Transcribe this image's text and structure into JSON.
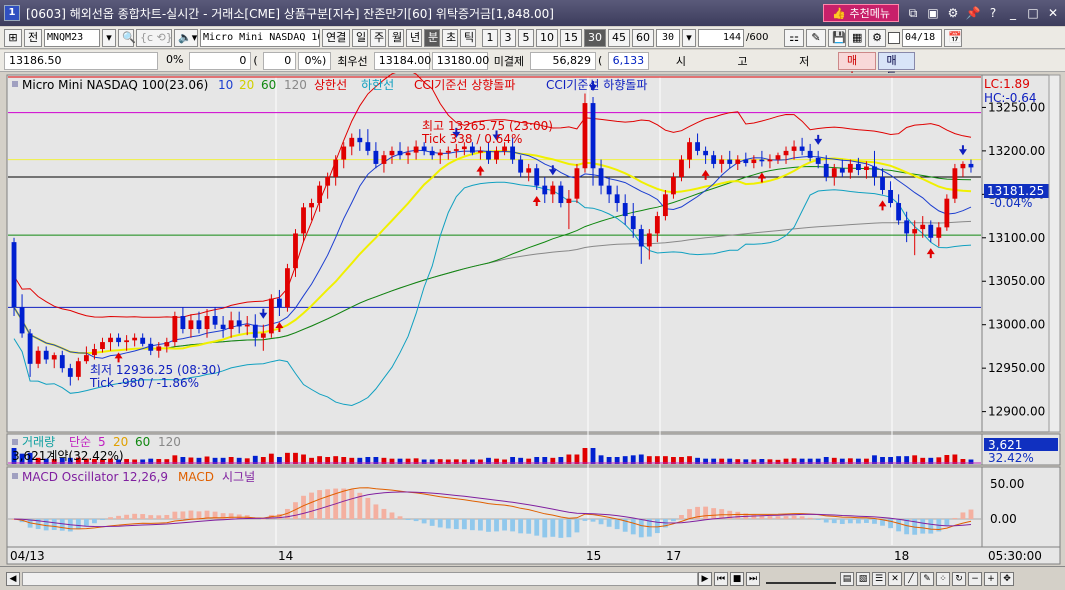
{
  "window": {
    "number": "1",
    "title": "[0603] 해외선옵 종합차트-실시간 - 거래소[CME] 상품구분[지수] 잔존만기[60] 위탁증거금[1,848.00]",
    "recommend_menu": "추천메뉴"
  },
  "toolbar": {
    "jeon": "전",
    "symbol": "MNQM23",
    "product_name": "Micro Mini NASDAQ 10",
    "yeongyeol": "연결",
    "periods": [
      "일",
      "주",
      "월",
      "년",
      "분",
      "초",
      "틱"
    ],
    "active_period": "분",
    "intervals": [
      "1",
      "3",
      "5",
      "10",
      "15",
      "30",
      "45",
      "60"
    ],
    "active_interval": "30",
    "interval_select": "30",
    "count": "144",
    "count_total": "/600",
    "date": "04/18"
  },
  "quote": {
    "price": "13186.50",
    "change": "0",
    "change_pct_tail": "0%",
    "paren_value": "0",
    "paren_pct": "0%)",
    "best_bid_label": "최우선",
    "best_bid": "13184.00",
    "best_ask": "13180.00",
    "open_interest_label": "미결제",
    "open_interest": "56,829",
    "oi_change": "6,133",
    "open_label": "시",
    "high_label": "고",
    "low_label": "저",
    "buy_label": "매수",
    "sell_label": "매도"
  },
  "price_panel": {
    "legend_name": "Micro Mini NASDAQ 100(23.06)",
    "ma_periods": [
      {
        "label": "10",
        "color": "#1c3ed0"
      },
      {
        "label": "20",
        "color": "#e0e000"
      },
      {
        "label": "60",
        "color": "#108810"
      },
      {
        "label": "120",
        "color": "#888888"
      }
    ],
    "upper_band_label": "상한선",
    "lower_band_label": "하한선",
    "cci_up_label": "CCI기준선 상향돌파",
    "cci_down_label": "CCI기준선 하향돌파",
    "lc_label": "LC:1.89",
    "hc_label": "HC:-0.64",
    "high_annot": "최고 13265.75 (23:00)",
    "high_tick": "Tick 338 / 0.64%",
    "low_annot": "최저 12936.25 (08:30)",
    "low_tick": "Tick -980 / -1.86%",
    "current_price_label": "13181.25",
    "current_pct_label": "-0.04%",
    "y_ticks": [
      "13250.00",
      "13200.00",
      "13150.00",
      "13100.00",
      "13050.00",
      "13000.00",
      "12950.00",
      "12900.00"
    ]
  },
  "volume_panel": {
    "label": "거래량",
    "ma_type": "단순",
    "ma_periods": [
      "5",
      "20",
      "60",
      "120"
    ],
    "contracts_label": "3,621계약(32.42%)",
    "value_label": "3,621",
    "pct_label": "32.42%"
  },
  "macd_panel": {
    "osc_label": "MACD Oscillator 12,26,9",
    "macd_label": "MACD",
    "signal_label": "시그널",
    "y_ticks": [
      "50.00",
      "0.00"
    ]
  },
  "x_axis": {
    "labels": [
      "04/13",
      "14",
      "15",
      "17",
      "18"
    ],
    "time_label": "05:30:00"
  },
  "chart_data": {
    "type": "candlestick",
    "ylim": [
      12880,
      13285
    ],
    "candles": [
      [
        13095,
        13100,
        13010,
        13020
      ],
      [
        13020,
        13035,
        12985,
        12990
      ],
      [
        12990,
        12995,
        12940,
        12955
      ],
      [
        12955,
        12975,
        12950,
        12970
      ],
      [
        12970,
        12975,
        12955,
        12960
      ],
      [
        12960,
        12968,
        12950,
        12965
      ],
      [
        12965,
        12970,
        12945,
        12950
      ],
      [
        12950,
        12955,
        12930,
        12940
      ],
      [
        12940,
        12962,
        12936,
        12958
      ],
      [
        12958,
        12975,
        12955,
        12965
      ],
      [
        12965,
        12978,
        12960,
        12972
      ],
      [
        12972,
        12985,
        12968,
        12980
      ],
      [
        12980,
        12990,
        12970,
        12985
      ],
      [
        12985,
        12990,
        12975,
        12980
      ],
      [
        12980,
        12988,
        12970,
        12982
      ],
      [
        12982,
        12990,
        12975,
        12985
      ],
      [
        12985,
        12990,
        12975,
        12978
      ],
      [
        12978,
        12985,
        12965,
        12970
      ],
      [
        12970,
        12980,
        12962,
        12975
      ],
      [
        12975,
        12985,
        12968,
        12980
      ],
      [
        12980,
        13015,
        12975,
        13010
      ],
      [
        13010,
        13020,
        12990,
        12995
      ],
      [
        12995,
        13012,
        12985,
        13005
      ],
      [
        13005,
        13015,
        12990,
        12995
      ],
      [
        12995,
        13018,
        12985,
        13010
      ],
      [
        13010,
        13020,
        12995,
        13000
      ],
      [
        13000,
        13010,
        12985,
        12995
      ],
      [
        12995,
        13015,
        12985,
        13005
      ],
      [
        13005,
        13015,
        12990,
        12998
      ],
      [
        12998,
        13010,
        12988,
        13000
      ],
      [
        13000,
        13012,
        12975,
        12985
      ],
      [
        12985,
        13000,
        12970,
        12990
      ],
      [
        12990,
        13035,
        12985,
        13030
      ],
      [
        13030,
        13040,
        13010,
        13020
      ],
      [
        13020,
        13070,
        13015,
        13065
      ],
      [
        13065,
        13110,
        13055,
        13105
      ],
      [
        13105,
        13140,
        13095,
        13135
      ],
      [
        13135,
        13145,
        13120,
        13140
      ],
      [
        13140,
        13165,
        13130,
        13160
      ],
      [
        13160,
        13175,
        13145,
        13170
      ],
      [
        13170,
        13195,
        13160,
        13190
      ],
      [
        13190,
        13210,
        13180,
        13205
      ],
      [
        13205,
        13220,
        13195,
        13215
      ],
      [
        13215,
        13225,
        13200,
        13210
      ],
      [
        13210,
        13225,
        13195,
        13200
      ],
      [
        13200,
        13210,
        13180,
        13185
      ],
      [
        13185,
        13200,
        13175,
        13195
      ],
      [
        13195,
        13205,
        13185,
        13200
      ],
      [
        13200,
        13210,
        13190,
        13195
      ],
      [
        13195,
        13205,
        13185,
        13198
      ],
      [
        13198,
        13212,
        13190,
        13205
      ],
      [
        13205,
        13210,
        13195,
        13200
      ],
      [
        13200,
        13205,
        13190,
        13195
      ],
      [
        13195,
        13202,
        13185,
        13198
      ],
      [
        13198,
        13205,
        13190,
        13200
      ],
      [
        13200,
        13208,
        13192,
        13202
      ],
      [
        13202,
        13210,
        13195,
        13205
      ],
      [
        13205,
        13210,
        13195,
        13198
      ],
      [
        13198,
        13205,
        13190,
        13200
      ],
      [
        13200,
        13210,
        13185,
        13190
      ],
      [
        13190,
        13205,
        13185,
        13200
      ],
      [
        13200,
        13210,
        13195,
        13205
      ],
      [
        13205,
        13215,
        13185,
        13190
      ],
      [
        13190,
        13195,
        13170,
        13175
      ],
      [
        13175,
        13185,
        13165,
        13180
      ],
      [
        13180,
        13185,
        13155,
        13160
      ],
      [
        13160,
        13170,
        13140,
        13150
      ],
      [
        13150,
        13165,
        13140,
        13160
      ],
      [
        13160,
        13165,
        13135,
        13140
      ],
      [
        13140,
        13155,
        13110,
        13145
      ],
      [
        13145,
        13185,
        13140,
        13180
      ],
      [
        13180,
        13266,
        13175,
        13255
      ],
      [
        13255,
        13262,
        13160,
        13180
      ],
      [
        13180,
        13190,
        13150,
        13160
      ],
      [
        13160,
        13170,
        13140,
        13150
      ],
      [
        13150,
        13160,
        13130,
        13140
      ],
      [
        13140,
        13150,
        13115,
        13125
      ],
      [
        13125,
        13140,
        13100,
        13110
      ],
      [
        13110,
        13115,
        13070,
        13090
      ],
      [
        13090,
        13110,
        13075,
        13105
      ],
      [
        13105,
        13130,
        13095,
        13125
      ],
      [
        13125,
        13155,
        13120,
        13150
      ],
      [
        13150,
        13175,
        13145,
        13170
      ],
      [
        13170,
        13195,
        13165,
        13190
      ],
      [
        13190,
        13215,
        13180,
        13210
      ],
      [
        13210,
        13220,
        13195,
        13200
      ],
      [
        13200,
        13205,
        13185,
        13195
      ],
      [
        13195,
        13200,
        13180,
        13185
      ],
      [
        13185,
        13195,
        13175,
        13190
      ],
      [
        13190,
        13200,
        13180,
        13185
      ],
      [
        13185,
        13195,
        13178,
        13190
      ],
      [
        13190,
        13198,
        13182,
        13186
      ],
      [
        13186,
        13195,
        13180,
        13190
      ],
      [
        13190,
        13200,
        13182,
        13188
      ],
      [
        13188,
        13196,
        13180,
        13190
      ],
      [
        13190,
        13198,
        13185,
        13195
      ],
      [
        13195,
        13205,
        13185,
        13200
      ],
      [
        13200,
        13212,
        13190,
        13205
      ],
      [
        13205,
        13215,
        13195,
        13200
      ],
      [
        13200,
        13208,
        13188,
        13192
      ],
      [
        13192,
        13200,
        13180,
        13185
      ],
      [
        13185,
        13195,
        13165,
        13170
      ],
      [
        13170,
        13185,
        13160,
        13180
      ],
      [
        13180,
        13190,
        13170,
        13175
      ],
      [
        13175,
        13190,
        13168,
        13185
      ],
      [
        13185,
        13192,
        13172,
        13178
      ],
      [
        13178,
        13188,
        13168,
        13182
      ],
      [
        13182,
        13200,
        13160,
        13170
      ],
      [
        13170,
        13180,
        13150,
        13155
      ],
      [
        13155,
        13165,
        13135,
        13140
      ],
      [
        13140,
        13150,
        13115,
        13120
      ],
      [
        13120,
        13130,
        13095,
        13105
      ],
      [
        13105,
        13120,
        13080,
        13110
      ],
      [
        13110,
        13125,
        13100,
        13115
      ],
      [
        13115,
        13120,
        13095,
        13100
      ],
      [
        13100,
        13118,
        13090,
        13112
      ],
      [
        13112,
        13150,
        13108,
        13145
      ],
      [
        13145,
        13185,
        13140,
        13180
      ],
      [
        13180,
        13188,
        13170,
        13185
      ],
      [
        13185,
        13190,
        13175,
        13181
      ]
    ]
  }
}
